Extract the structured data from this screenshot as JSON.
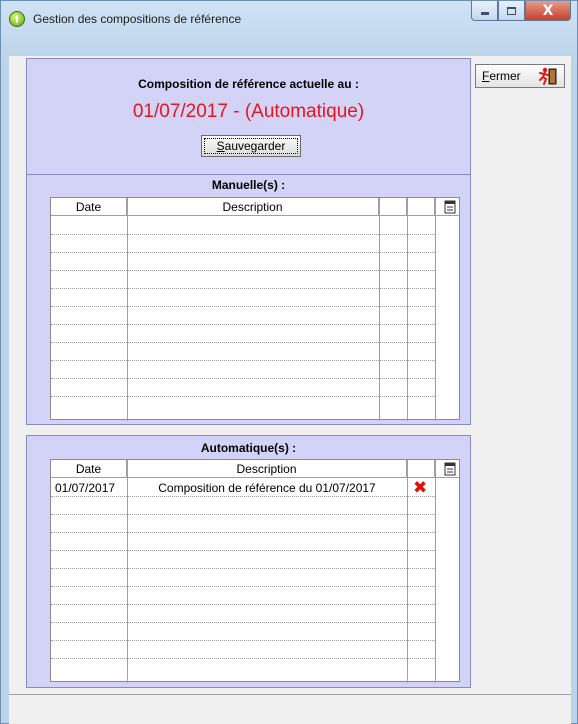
{
  "window": {
    "title": "Gestion des compositions de référence",
    "caption_buttons": {
      "close_glyph": "X"
    }
  },
  "toolbar": {
    "close_button": {
      "label_first": "F",
      "label_rest": "ermer",
      "icon": "exit-running-man-icon"
    }
  },
  "current": {
    "heading": "Composition de référence actuelle au :",
    "value": "01/07/2017 - (Automatique)",
    "save_first": "S",
    "save_rest": "auvegarder"
  },
  "manual": {
    "heading": "Manuelle(s) :",
    "columns": [
      "Date",
      "Description"
    ],
    "column_icon": "table-settings-icon",
    "rows": []
  },
  "automatic": {
    "heading": "Automatique(s) :",
    "columns": [
      "Date",
      "Description"
    ],
    "column_icon": "table-settings-icon",
    "rows": [
      {
        "date": "01/07/2017",
        "description": "Composition de référence du 01/07/2017",
        "action_icon": "delete-x-icon"
      }
    ]
  },
  "colors": {
    "panel_bg": "#d3d3f7",
    "accent_red": "#e8141e",
    "delete_red": "#e0100a"
  }
}
